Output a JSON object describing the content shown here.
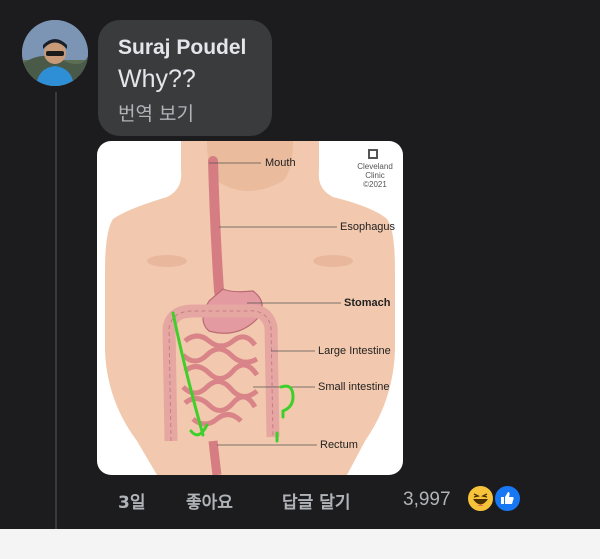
{
  "comment": {
    "author": "Suraj Poudel",
    "text": "Why??",
    "translate_label": "번역 보기"
  },
  "image": {
    "brand": "Cleveland Clinic",
    "brand_line1": "Cleveland",
    "brand_line2": "Clinic",
    "copyright": "©2021",
    "labels": {
      "mouth": "Mouth",
      "esophagus": "Esophagus",
      "stomach": "Stomach",
      "large_intestine": "Large Intestine",
      "small_intestine": "Small intestine",
      "rectum": "Rectum"
    },
    "annotation_color": "#3fcf2a"
  },
  "actions": {
    "time": "3일",
    "like": "좋아요",
    "reply": "답글 달기",
    "reaction_count": "3,997"
  },
  "reactions": [
    {
      "icon": "haha-reaction-icon",
      "color": "#f7c33a"
    },
    {
      "icon": "like-reaction-icon",
      "color": "#1877f2"
    }
  ]
}
